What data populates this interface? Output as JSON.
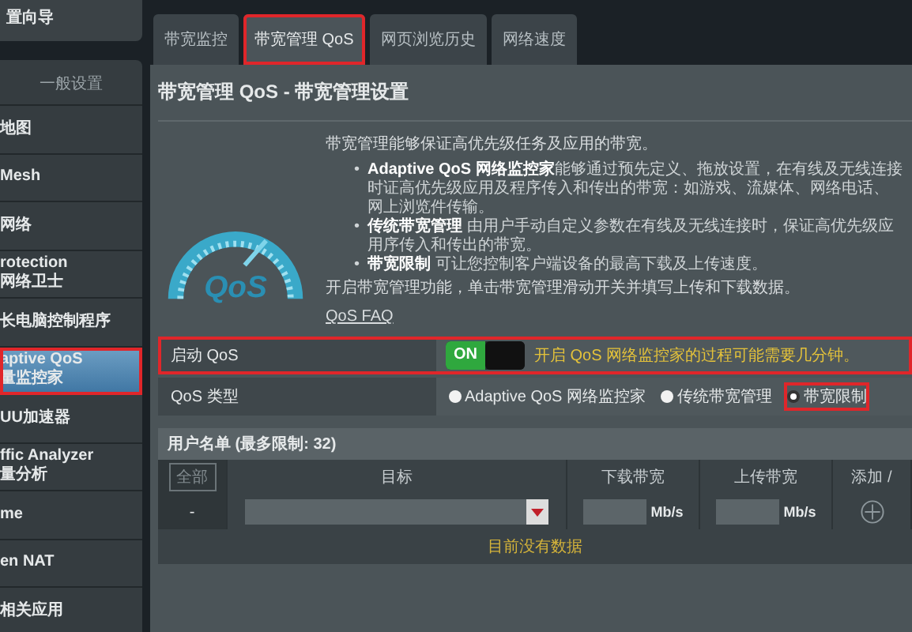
{
  "sidebar": {
    "top_item": "置向导",
    "section_title": "一般设置",
    "items": [
      {
        "lines": [
          "地图"
        ],
        "selected": false,
        "annotated": false
      },
      {
        "lines": [
          "Mesh"
        ],
        "selected": false,
        "annotated": false
      },
      {
        "lines": [
          "网络"
        ],
        "selected": false,
        "annotated": false
      },
      {
        "lines": [
          "rotection",
          "网络卫士"
        ],
        "selected": false,
        "annotated": false
      },
      {
        "lines": [
          "长电脑控制程序"
        ],
        "selected": false,
        "annotated": false
      },
      {
        "lines": [
          "aptive QoS",
          "量监控家"
        ],
        "selected": true,
        "annotated": true
      },
      {
        "lines": [
          "UU加速器"
        ],
        "selected": false,
        "annotated": false
      },
      {
        "lines": [
          "ffic Analyzer",
          "量分析"
        ],
        "selected": false,
        "annotated": false
      },
      {
        "lines": [
          "me"
        ],
        "selected": false,
        "annotated": false
      },
      {
        "lines": [
          "en NAT"
        ],
        "selected": false,
        "annotated": false
      },
      {
        "lines": [
          "相关应用"
        ],
        "selected": false,
        "annotated": false
      }
    ]
  },
  "tabs": [
    {
      "label": "带宽监控",
      "selected": false,
      "annotated": false
    },
    {
      "label": "带宽管理 QoS",
      "selected": true,
      "annotated": true
    },
    {
      "label": "网页浏览历史",
      "selected": false,
      "annotated": false
    },
    {
      "label": "网络速度",
      "selected": false,
      "annotated": false
    }
  ],
  "page_title": "带宽管理 QoS - 带宽管理设置",
  "intro": "带宽管理能够保证高优先级任务及应用的带宽。",
  "logo_text": "QoS",
  "bullets": [
    {
      "marker": "•",
      "text": "**Adaptive QoS 网络监控家**能够通过预先定义、拖放设置，在有线及无线连接时证高优先级应用及程序传入和传出的带宽：如游戏、流媒体、网络电话、网上浏览件传输。"
    },
    {
      "marker": "•",
      "text": "**传统带宽管理** 由用户手动自定义参数在有线及无线连接时，保证高优先级应用序传入和传出的带宽。"
    },
    {
      "marker": "•",
      "text": "**带宽限制** 可让您控制客户端设备的最高下载及上传速度。"
    }
  ],
  "instruction": "开启带宽管理功能，单击带宽管理滑动开关并填写上传和下载数据。",
  "faq_link": "QoS FAQ",
  "enable_row": {
    "label": "启动 QoS",
    "toggle": {
      "on": true,
      "label": "ON"
    },
    "note": "开启 QoS 网络监控家的过程可能需要几分钟。",
    "annotated": true
  },
  "type_row": {
    "label": "QoS 类型",
    "options": [
      {
        "label": "Adaptive QoS 网络监控家",
        "selected": false,
        "annotated": false
      },
      {
        "label": "传统带宽管理",
        "selected": false,
        "annotated": false
      },
      {
        "label": "带宽限制",
        "selected": true,
        "annotated": true
      }
    ]
  },
  "user_table": {
    "title": "用户名单 (最多限制: 32)",
    "all_button": "全部",
    "columns": [
      "目标",
      "下载带宽",
      "上传带宽",
      "添加 /"
    ],
    "input_row": {
      "index": "-",
      "download_unit": "Mb/s",
      "upload_unit": "Mb/s"
    },
    "empty_message": "目前没有数据"
  }
}
